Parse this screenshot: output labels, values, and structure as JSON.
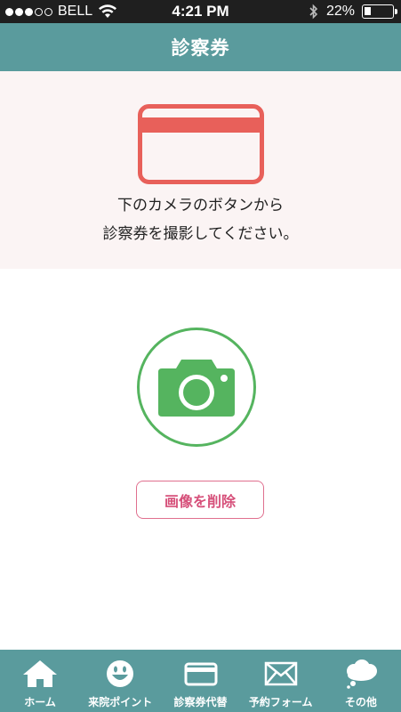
{
  "status_bar": {
    "carrier": "BELL",
    "time": "4:21 PM",
    "battery_percent": "22%",
    "battery_level": 0.22,
    "signal_bars_filled": 3,
    "signal_bars_total": 5
  },
  "header": {
    "title": "診察券"
  },
  "instruction": {
    "line1": "下のカメラのボタンから",
    "line2": "診察券を撮影してください。"
  },
  "delete_button": {
    "label": "画像を削除"
  },
  "tabs": [
    {
      "label": "ホーム",
      "icon": "home-icon"
    },
    {
      "label": "来院ポイント",
      "icon": "smiley-icon"
    },
    {
      "label": "診察券代替",
      "icon": "card-icon"
    },
    {
      "label": "予約フォーム",
      "icon": "mail-icon"
    },
    {
      "label": "その他",
      "icon": "speech-bubble-icon"
    }
  ],
  "colors": {
    "header": "#5a9b9d",
    "card_icon": "#e8605a",
    "camera": "#55b45f",
    "delete_text": "#d6507a",
    "panel_bg": "#fbf4f4"
  }
}
